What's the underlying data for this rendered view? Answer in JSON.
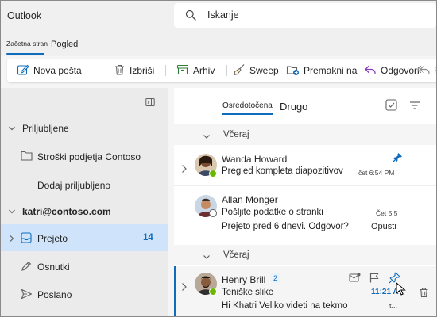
{
  "app": {
    "title": "Outlook"
  },
  "search": {
    "text": "Iskanje"
  },
  "tabs": [
    {
      "label": "Začetna stran",
      "active": true
    },
    {
      "label": "Pogled",
      "active": false
    }
  ],
  "ribbon": {
    "new_mail": "Nova pošta",
    "delete": "Izbriši",
    "archive": "Arhiv",
    "sweep": "Sweep",
    "move_to": "Premakni na",
    "reply": "Odgovori",
    "reply_all_partial": "Re"
  },
  "sidebar": {
    "favorites_label": "Priljubljene",
    "favorites": [
      {
        "label": "Stroški podjetja Contoso"
      },
      {
        "label": "Dodaj priljubljeno"
      }
    ],
    "account": "katri@contoso.com",
    "folders": [
      {
        "label": "Prejeto",
        "count": "14",
        "selected": true
      },
      {
        "label": "Osnutki"
      },
      {
        "label": "Poslano"
      }
    ]
  },
  "list": {
    "pivot_focused": "Osredotočena",
    "pivot_other": "Drugo",
    "groups": [
      {
        "label": "Včeraj"
      },
      {
        "label": "Včeraj"
      }
    ],
    "messages": [
      {
        "sender": "Wanda Howard",
        "subject": "Pregled kompleta diapozitivov",
        "time": "čet 6:54 PM",
        "pinned": true,
        "presence": "available"
      },
      {
        "sender": "Allan Monger",
        "subject": "Pošljite podatke o stranki",
        "preview": "Prejeto pred 6 dnevi. Odgovor?",
        "time": "Čet 5:5",
        "action": "Opusti",
        "presence": "away"
      },
      {
        "sender": "Henry Brill",
        "count": "2",
        "subject": "Teniške slike",
        "preview": "Hi Khatri Veliko videti na tekmo",
        "time": "11:21 A",
        "preview_tail": "t...",
        "selected": true,
        "presence": "available"
      }
    ]
  },
  "colors": {
    "accent": "#0f6cbd",
    "selected_folder_bg": "#cfe4fa",
    "presence_available": "#6bb700",
    "sidebar_bg": "#ebebeb"
  }
}
